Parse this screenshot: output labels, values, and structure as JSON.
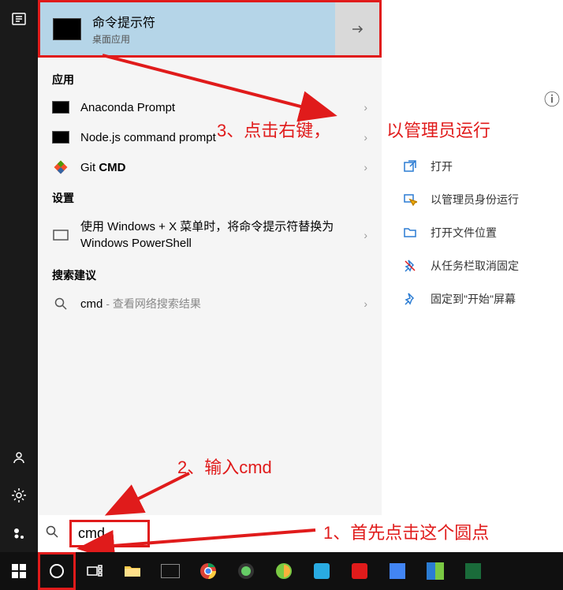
{
  "best_match": {
    "title": "命令提示符",
    "subtitle": "桌面应用"
  },
  "sections": {
    "apps": "应用",
    "settings": "设置",
    "suggestions": "搜索建议"
  },
  "app_results": [
    {
      "label": "Anaconda Prompt"
    },
    {
      "label": "Node.js command prompt"
    },
    {
      "label_prefix": "Git ",
      "label_bold": "CMD"
    }
  ],
  "settings_results": [
    {
      "label": "使用 Windows + X 菜单时，将命令提示符替换为 Windows PowerShell"
    }
  ],
  "suggestion": {
    "label": "cmd",
    "sub": "- 查看网络搜索结果"
  },
  "search": {
    "value": "cmd"
  },
  "context_menu": [
    {
      "icon": "open-icon",
      "label": "打开"
    },
    {
      "icon": "admin-icon",
      "label": "以管理员身份运行"
    },
    {
      "icon": "folder-icon",
      "label": "打开文件位置"
    },
    {
      "icon": "unpin-taskbar-icon",
      "label": "从任务栏取消固定"
    },
    {
      "icon": "pin-start-icon",
      "label": "固定到\"开始\"屏幕"
    }
  ],
  "annotations": {
    "step1": "1、首先点击这个圆点",
    "step2": "2、输入cmd",
    "step3a": "3、点击右键，",
    "step3b": "以管理员运行"
  },
  "colors": {
    "annotation": "#e01b1b",
    "highlight_bg": "#b5d5e8"
  }
}
